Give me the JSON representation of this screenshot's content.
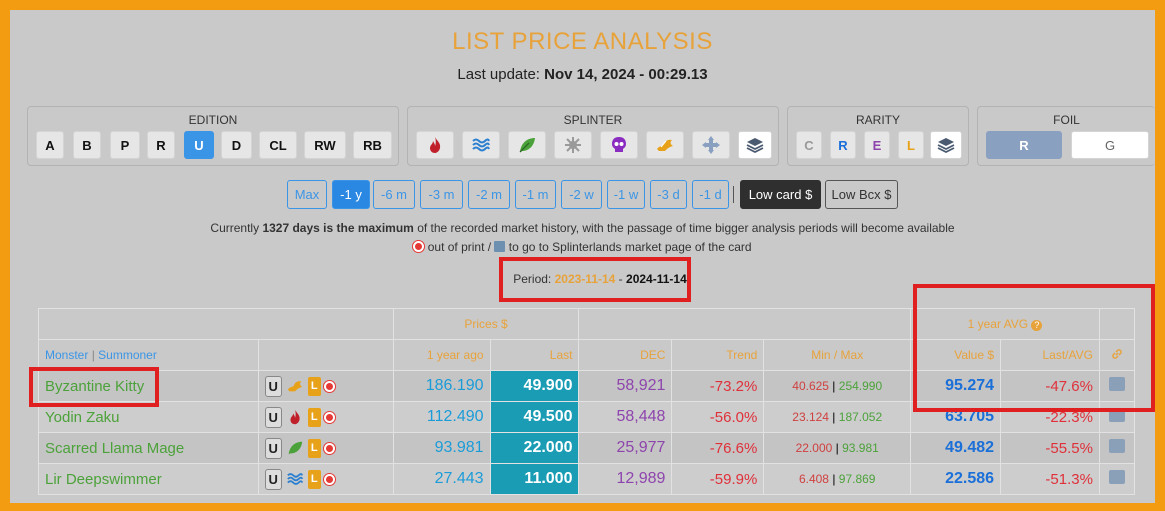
{
  "title": "LIST PRICE ANALYSIS",
  "last_update_label": "Last update:",
  "last_update_value": "Nov 14, 2024 - 00:29.13",
  "edition": {
    "label": "EDITION",
    "buttons": [
      "A",
      "B",
      "P",
      "R",
      "U",
      "D",
      "CL",
      "RW",
      "RB"
    ],
    "selected": "U"
  },
  "splinter": {
    "label": "SPLINTER",
    "icons": [
      "fire-icon",
      "water-icon",
      "earth-icon",
      "life-icon",
      "death-icon",
      "dragon-icon",
      "neutral-icon",
      "all-layers-icon"
    ]
  },
  "rarity": {
    "label": "RARITY",
    "buttons": [
      "C",
      "R",
      "E",
      "L"
    ],
    "colors": {
      "C": "#999999",
      "R": "#1a6fd8",
      "E": "#8e44ad",
      "L": "#e8a21a"
    }
  },
  "foil": {
    "label": "FOIL",
    "buttons": [
      "R",
      "G"
    ],
    "selected": "R"
  },
  "periods": [
    "Max",
    "-1 y",
    "-6 m",
    "-3 m",
    "-2 m",
    "-1 m",
    "-2 w",
    "-1 w",
    "-3 d",
    "-1 d"
  ],
  "period_selected": "-1 y",
  "mode_buttons": [
    "Low card $",
    "Low Bcx $"
  ],
  "info": {
    "line1_a": "Currently ",
    "line1_b": "1327 days is the maximum",
    "line1_c": " of the recorded market history, with the passage of time bigger analysis periods will become available",
    "line2_a": " out of print / ",
    "line2_b": " to go to Splinterlands market page of the card"
  },
  "period_range": {
    "label": "Period:",
    "from": "2023-11-14",
    "sep": " - ",
    "to": "2024-11-14"
  },
  "table": {
    "group_prices": "Prices $",
    "group_avg": "1 year AVG",
    "col_monster": "Monster",
    "col_sep": " | ",
    "col_summoner": "Summoner",
    "col_ago": "1 year ago",
    "col_last": "Last",
    "col_dec": "DEC",
    "col_trend": "Trend",
    "col_minmax": "Min / Max",
    "col_value": "Value $",
    "col_lastavg": "Last/AVG",
    "rows": [
      {
        "name": "Byzantine Kitty",
        "edition": "U",
        "element": "dragon",
        "rarity": "L",
        "ago": "186.190",
        "last": "49.900",
        "dec": "58,921",
        "trend": "-73.2%",
        "min": "40.625",
        "max": "254.990",
        "value": "95.274",
        "lastavg": "-47.6%"
      },
      {
        "name": "Yodin Zaku",
        "edition": "U",
        "element": "fire",
        "rarity": "L",
        "ago": "112.490",
        "last": "49.500",
        "dec": "58,448",
        "trend": "-56.0%",
        "min": "23.124",
        "max": "187.052",
        "value": "63.705",
        "lastavg": "-22.3%"
      },
      {
        "name": "Scarred Llama Mage",
        "edition": "U",
        "element": "earth",
        "rarity": "L",
        "ago": "93.981",
        "last": "22.000",
        "dec": "25,977",
        "trend": "-76.6%",
        "min": "22.000",
        "max": "93.981",
        "value": "49.482",
        "lastavg": "-55.5%"
      },
      {
        "name": "Lir Deepswimmer",
        "edition": "U",
        "element": "water",
        "rarity": "L",
        "ago": "27.443",
        "last": "11.000",
        "dec": "12,989",
        "trend": "-59.9%",
        "min": "6.408",
        "max": "97.869",
        "value": "22.586",
        "lastavg": "-51.3%"
      }
    ]
  }
}
